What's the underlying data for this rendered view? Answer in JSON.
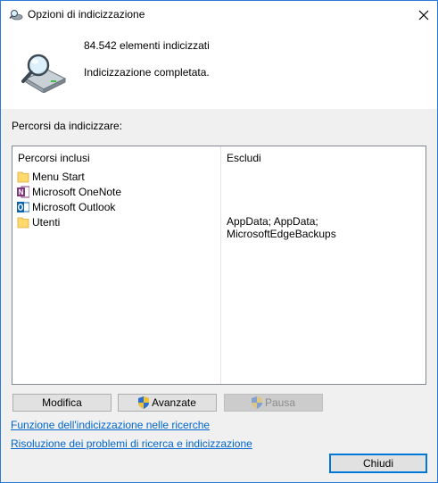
{
  "window": {
    "title": "Opzioni di indicizzazione"
  },
  "summary": {
    "count_text": "84.542 elementi indicizzati",
    "status_text": "Indicizzazione completata."
  },
  "locations": {
    "section_label": "Percorsi da indicizzare:",
    "columns": {
      "included": "Percorsi inclusi",
      "exclude": "Escludi"
    },
    "rows": [
      {
        "name": "Menu Start",
        "icon": "folder-icon",
        "exclude": ""
      },
      {
        "name": "Microsoft OneNote",
        "icon": "onenote-icon",
        "exclude": ""
      },
      {
        "name": "Microsoft Outlook",
        "icon": "outlook-icon",
        "exclude": ""
      },
      {
        "name": "Utenti",
        "icon": "folder-icon",
        "exclude": "AppData; AppData; MicrosoftEdgeBackups"
      }
    ]
  },
  "buttons": {
    "modify": "Modifica",
    "advanced": "Avanzate",
    "pause": "Pausa",
    "close": "Chiudi"
  },
  "links": {
    "how_indexing": "Funzione dell'indicizzazione nelle ricerche",
    "troubleshoot": "Risoluzione dei problemi di ricerca e indicizzazione"
  },
  "colors": {
    "accent": "#0078d7",
    "link": "#0066cc",
    "onenote": "#80397b",
    "outlook": "#0a64ad",
    "folder": "#ffd96b"
  }
}
